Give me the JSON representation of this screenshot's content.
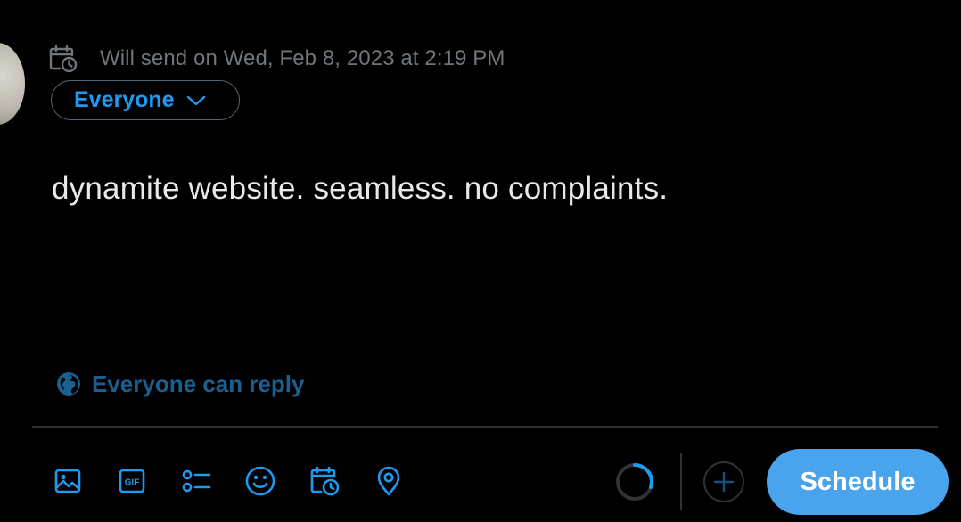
{
  "composer": {
    "scheduled_text": "Will send on Wed, Feb 8, 2023 at 2:19 PM",
    "audience_label": "Everyone",
    "draft_text": "dynamite website. seamless. no complaints.",
    "reply_setting_label": "Everyone can reply"
  },
  "toolbar": {
    "icons": [
      "image-icon",
      "gif-icon",
      "poll-icon",
      "emoji-icon",
      "schedule-icon",
      "location-icon"
    ],
    "gif_glyph": "GIF",
    "character_progress": 0.3,
    "schedule_button_label": "Schedule"
  },
  "colors": {
    "background": "#000000",
    "accent": "#1d9bf0",
    "schedule_button": "#4aa3ed",
    "muted_text": "#71767b",
    "primary_text": "#e7e9ea",
    "divider": "#2f3336"
  }
}
